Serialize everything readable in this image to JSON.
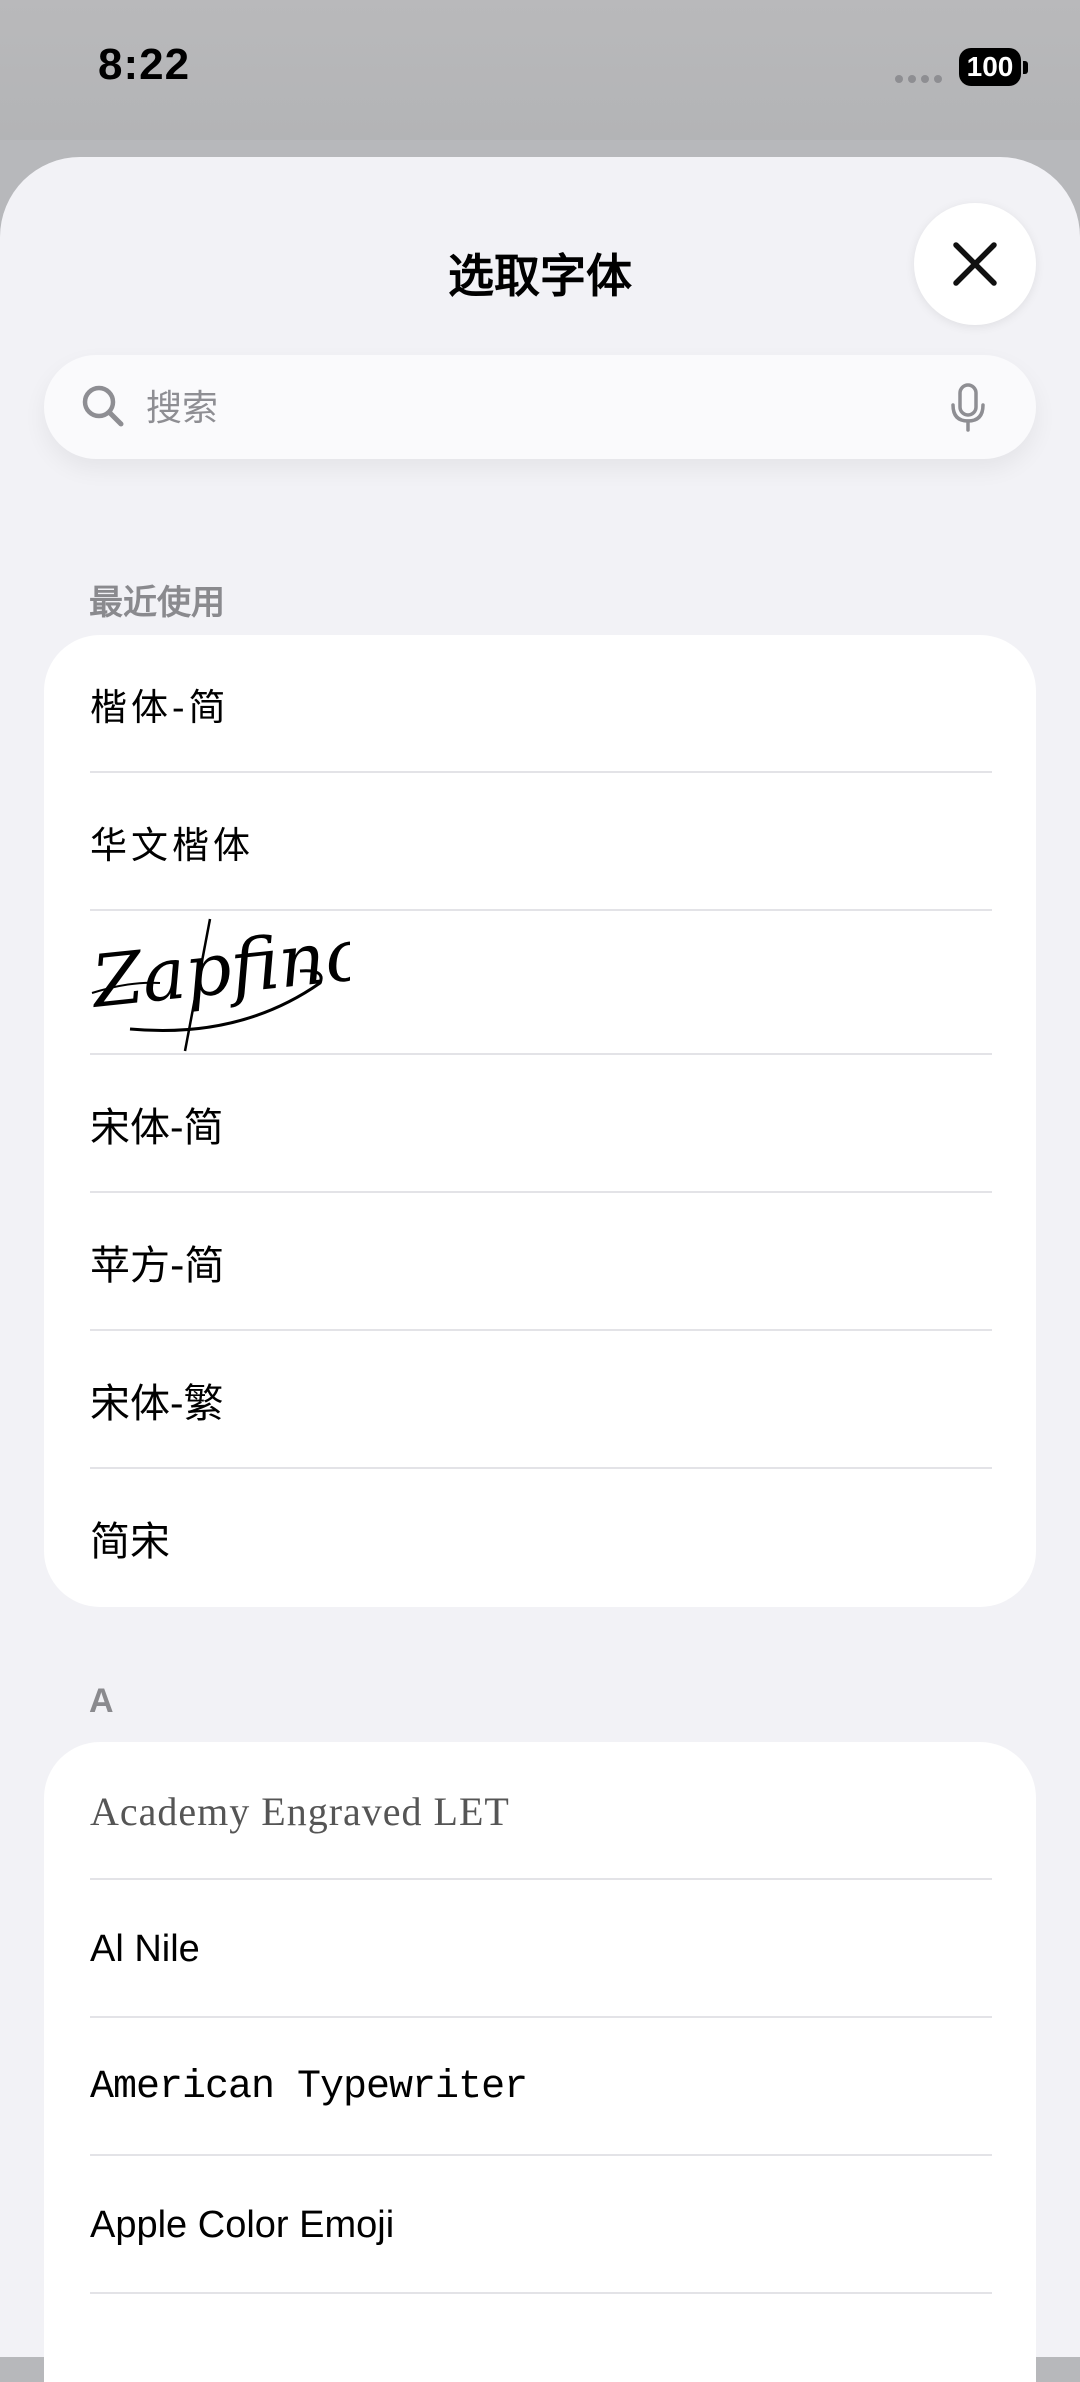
{
  "status_bar": {
    "time": "8:22",
    "battery": "100"
  },
  "sheet": {
    "title": "选取字体",
    "search": {
      "placeholder": "搜索",
      "value": ""
    }
  },
  "recent": {
    "header": "最近使用",
    "fonts": [
      "楷体-简",
      "华文楷体",
      "Zapfino",
      "宋体-简",
      "苹方-简",
      "宋体-繁",
      "简宋"
    ]
  },
  "section_a": {
    "header": "A",
    "fonts": [
      "Academy Engraved LET",
      "Al Nile",
      "American Typewriter",
      "Apple Color Emoji"
    ]
  },
  "icons": {
    "close": "close-icon",
    "search": "search-icon",
    "mic": "microphone-icon"
  },
  "colors": {
    "sheet_bg": "#f2f2f6",
    "card_bg": "#ffffff",
    "section_header": "#8a8a8e",
    "placeholder": "#8e8e93"
  }
}
